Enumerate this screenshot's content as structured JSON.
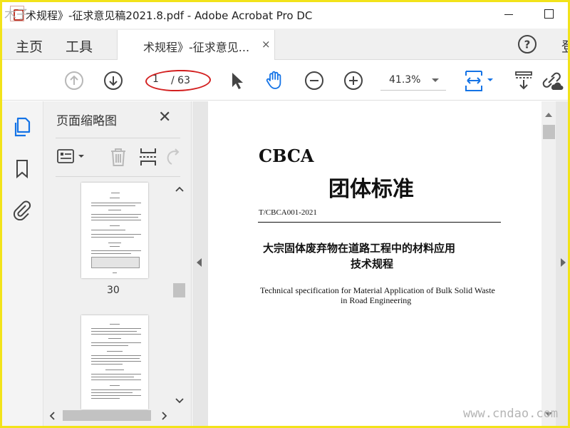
{
  "window": {
    "title": "术规程》-征求意见稿2021.8.pdf - Adobe Acrobat Pro DC"
  },
  "tabs": {
    "home": "主页",
    "tools": "工具",
    "document": "术规程》-征求意见...",
    "close_symbol": "×",
    "login_partial": "登"
  },
  "toolbar": {
    "current_page": "1",
    "total_pages": "/ 63",
    "zoom": "41.3%"
  },
  "thumbnails_panel": {
    "title": "页面缩略图",
    "close_symbol": "✕",
    "visible_page_label": "30"
  },
  "document": {
    "org": "CBCA",
    "doc_type": "团体标准",
    "code": "T/CBCA001-2021",
    "title_cn_line1": "大宗固体废弃物在道路工程中的材料应用",
    "title_cn_line2": "技术规程",
    "title_en_line1": "Technical specification for Material Application of Bulk Solid Waste",
    "title_en_line2": "in Road Engineering"
  },
  "watermark": {
    "text": "www.cndao.com",
    "corner_text": "木子"
  },
  "colors": {
    "highlight_ring": "#d32020",
    "frame": "#f2e31a",
    "hand_tool": "#1473e6"
  }
}
